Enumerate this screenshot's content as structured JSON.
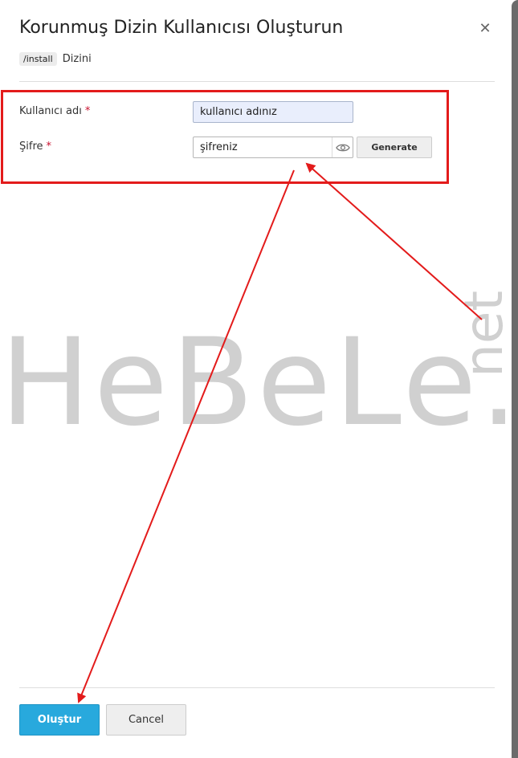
{
  "dialog": {
    "title": "Korunmuş Dizin Kullanıcısı Oluşturun",
    "close_icon": "close-icon",
    "directory_path": "/install",
    "directory_suffix": "Dizini"
  },
  "form": {
    "username_label": "Kullanıcı adı",
    "username_value": "kullanıcı adınız",
    "password_label": "Şifre",
    "password_value": "şifreniz",
    "required_marker": "*",
    "generate_label": "Generate",
    "eye_icon": "eye-icon"
  },
  "footer": {
    "submit_label": "Oluştur",
    "cancel_label": "Cancel"
  },
  "watermark": {
    "brand": "HeBeLe",
    "dot": ".",
    "tld": "net"
  },
  "colors": {
    "primary": "#28a9dd",
    "annotation": "#e31b1b",
    "required": "#c8102e",
    "watermark": "#d0d0d0"
  }
}
